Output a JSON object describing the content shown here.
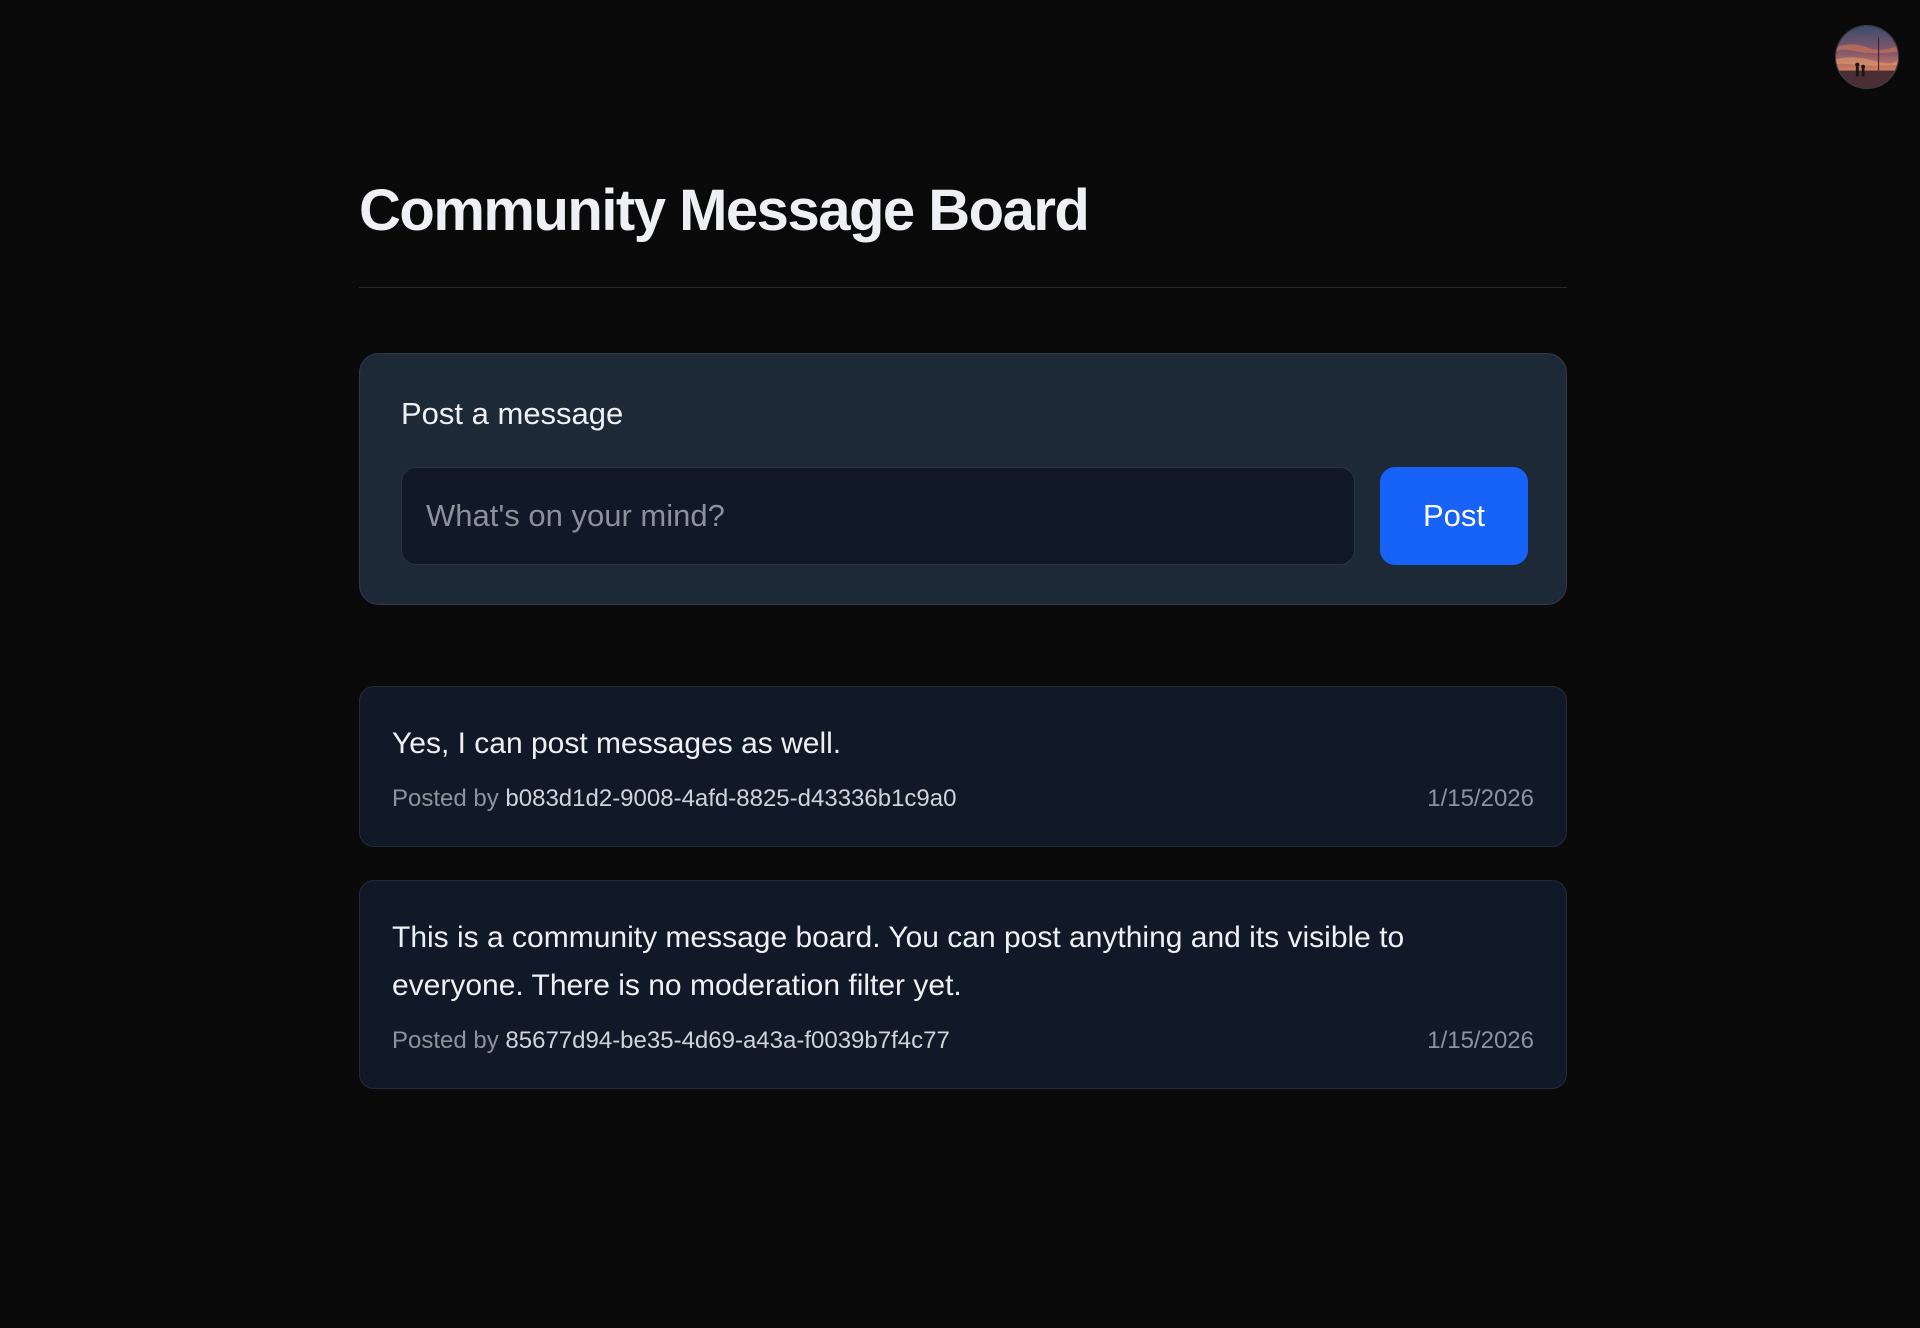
{
  "header": {
    "title": "Community Message Board"
  },
  "user": {
    "avatar_icon": "user-avatar-photo"
  },
  "composer": {
    "heading": "Post a message",
    "input_placeholder": "What's on your mind?",
    "input_value": "",
    "submit_label": "Post",
    "accent_color": "#1762f7"
  },
  "messages": [
    {
      "text": "Yes, I can post messages as well.",
      "posted_by_label": "Posted by",
      "author_id": "b083d1d2-9008-4afd-8825-d43336b1c9a0",
      "date": "1/15/2026"
    },
    {
      "text": "This is a community message board. You can post anything and its visible to everyone. There is no moderation filter yet.",
      "posted_by_label": "Posted by",
      "author_id": "85677d94-be35-4d69-a43a-f0039b7f4c77",
      "date": "1/15/2026"
    }
  ]
}
